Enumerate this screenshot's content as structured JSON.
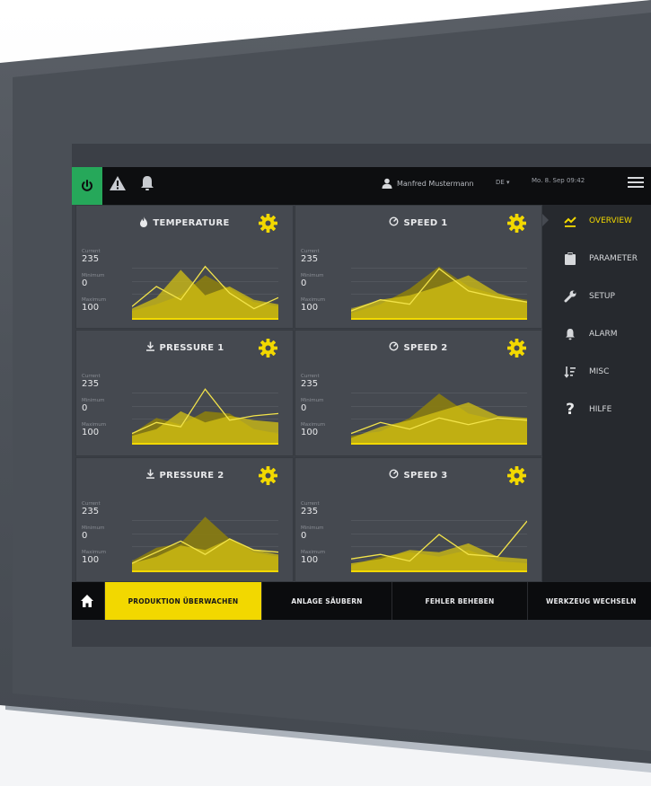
{
  "header": {
    "user_name": "Manfred Mustermann",
    "language": "DE ▾",
    "datetime": "Mo. 8. Sep 09:42"
  },
  "colors": {
    "accent": "#f2d800",
    "power": "#26a85a",
    "panel": "#454950",
    "bar": "#0d0e10"
  },
  "icons": {
    "power": "power-icon",
    "warning": "warning-icon",
    "bell": "bell-icon",
    "user": "user-icon",
    "menu": "menu-icon",
    "home": "home-icon"
  },
  "cards": [
    {
      "title": "TEMPERATURE",
      "icon": "flame-icon",
      "stats": [
        {
          "label": "Current",
          "value": "235"
        },
        {
          "label": "Minimum",
          "value": "0"
        },
        {
          "label": "Maximum",
          "value": "100"
        }
      ],
      "series_a": [
        8,
        14,
        22,
        40,
        28,
        16,
        12
      ],
      "series_b": [
        10,
        20,
        45,
        22,
        30,
        18,
        14
      ],
      "line": [
        12,
        30,
        18,
        48,
        24,
        10,
        20
      ]
    },
    {
      "title": "SPEED 1",
      "icon": "gauge-icon",
      "stats": [
        {
          "label": "Current",
          "value": "235"
        },
        {
          "label": "Minimum",
          "value": "0"
        },
        {
          "label": "Maximum",
          "value": "100"
        }
      ],
      "series_a": [
        6,
        14,
        28,
        48,
        30,
        22,
        18
      ],
      "series_b": [
        10,
        18,
        22,
        30,
        40,
        24,
        16
      ],
      "line": [
        8,
        18,
        14,
        46,
        26,
        20,
        16
      ]
    },
    {
      "title": "PRESSURE 1",
      "icon": "download-icon",
      "stats": [
        {
          "label": "Current",
          "value": "235"
        },
        {
          "label": "Minimum",
          "value": "0"
        },
        {
          "label": "Maximum",
          "value": "100"
        }
      ],
      "series_a": [
        10,
        24,
        18,
        30,
        28,
        14,
        10
      ],
      "series_b": [
        8,
        14,
        30,
        20,
        26,
        22,
        20
      ],
      "line": [
        10,
        20,
        16,
        50,
        22,
        26,
        28
      ]
    },
    {
      "title": "SPEED 2",
      "icon": "gauge-icon",
      "stats": [
        {
          "label": "Current",
          "value": "235"
        },
        {
          "label": "Minimum",
          "value": "0"
        },
        {
          "label": "Maximum",
          "value": "100"
        }
      ],
      "series_a": [
        8,
        12,
        24,
        46,
        28,
        22,
        24
      ],
      "series_b": [
        6,
        16,
        22,
        30,
        38,
        26,
        24
      ],
      "line": [
        10,
        20,
        14,
        24,
        18,
        24,
        22
      ]
    },
    {
      "title": "PRESSURE 2",
      "icon": "download-icon",
      "stats": [
        {
          "label": "Current",
          "value": "235"
        },
        {
          "label": "Minimum",
          "value": "0"
        },
        {
          "label": "Maximum",
          "value": "100"
        }
      ],
      "series_a": [
        10,
        22,
        26,
        50,
        30,
        18,
        14
      ],
      "series_b": [
        8,
        14,
        24,
        20,
        30,
        20,
        16
      ],
      "line": [
        8,
        18,
        28,
        16,
        30,
        20,
        18
      ]
    },
    {
      "title": "SPEED 3",
      "icon": "gauge-icon",
      "stats": [
        {
          "label": "Current",
          "value": "235"
        },
        {
          "label": "Minimum",
          "value": "0"
        },
        {
          "label": "Maximum",
          "value": "100"
        }
      ],
      "series_a": [
        6,
        14,
        18,
        14,
        20,
        10,
        8
      ],
      "series_b": [
        8,
        12,
        20,
        18,
        26,
        14,
        12
      ],
      "line": [
        12,
        16,
        10,
        34,
        16,
        14,
        46
      ]
    }
  ],
  "sidebar": {
    "items": [
      {
        "label": "OVERVIEW",
        "icon": "chart-line-icon",
        "active": true
      },
      {
        "label": "PARAMETER",
        "icon": "clipboard-icon",
        "active": false
      },
      {
        "label": "SETUP",
        "icon": "wrench-icon",
        "active": false
      },
      {
        "label": "ALARM",
        "icon": "bell-icon",
        "active": false
      },
      {
        "label": "MISC",
        "icon": "sort-icon",
        "active": false
      },
      {
        "label": "HILFE",
        "icon": "question-icon",
        "active": false
      }
    ]
  },
  "bottom": {
    "tabs": [
      {
        "label": "PRODUKTION ÜBERWACHEN",
        "active": true
      },
      {
        "label": "ANLAGE SÄUBERN",
        "active": false
      },
      {
        "label": "FEHLER BEHEBEN",
        "active": false
      },
      {
        "label": "WERKZEUG WECHSELN",
        "active": false
      }
    ]
  }
}
